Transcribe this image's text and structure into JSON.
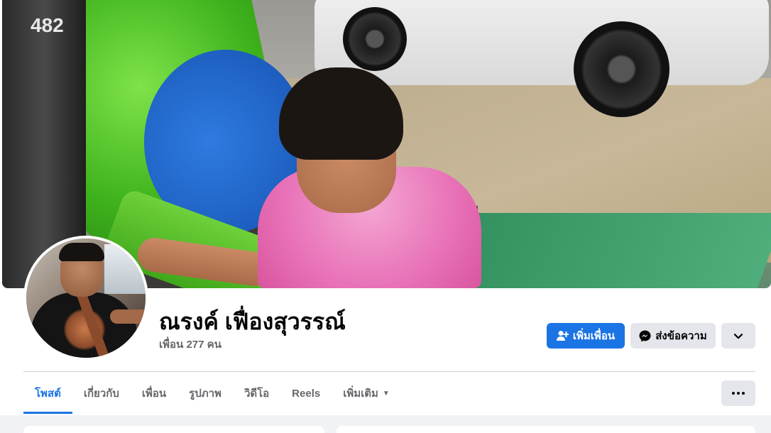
{
  "profile": {
    "name": "ณรงค์ เฟื่องสุวรรณ์",
    "friends_text": "เพื่อน 277 คน"
  },
  "cover": {
    "pole_number": "482"
  },
  "actions": {
    "add_friend_label": "เพิ่มเพื่อน",
    "message_label": "ส่งข้อความ",
    "more_icon": "chevron-down-icon"
  },
  "tabs": [
    {
      "label": "โพสต์",
      "active": true
    },
    {
      "label": "เกี่ยวกับ",
      "active": false
    },
    {
      "label": "เพื่อน",
      "active": false
    },
    {
      "label": "รูปภาพ",
      "active": false
    },
    {
      "label": "วิดีโอ",
      "active": false
    },
    {
      "label": "Reels",
      "active": false
    },
    {
      "label": "เพิ่มเติม",
      "active": false
    }
  ],
  "colors": {
    "accent": "#1b74e4",
    "button_secondary": "#e4e6eb",
    "text_secondary": "#65676b",
    "background": "#f0f2f5"
  }
}
